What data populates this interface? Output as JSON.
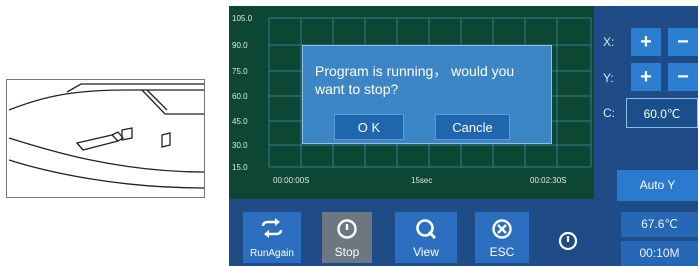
{
  "chart": {
    "y_ticks": [
      "105.0",
      "90.0",
      "75.0",
      "60.0",
      "45.0",
      "30.0",
      "15.0"
    ],
    "x_labels": [
      "00:00:00S",
      "15sec",
      "00:02:30S"
    ]
  },
  "dialog": {
    "message": "Program is running， would you want to stop?",
    "ok_label": "O K",
    "cancel_label": "Cancle"
  },
  "right_panel": {
    "x_label": "X:",
    "y_label": "Y:",
    "c_label": "C:",
    "plus": "+",
    "minus": "−",
    "c_value": "60.0℃",
    "auto_y_label": "Auto Y",
    "temperature": "67.6℃",
    "time": "00:10M"
  },
  "toolbar": {
    "run_again": "RunAgain",
    "stop": "Stop",
    "view": "View",
    "esc": "ESC"
  },
  "colors": {
    "chart_bg": "#0d4633",
    "panel_bg": "#1f4b86",
    "dialog_bg": "#3c86c6",
    "button_blue": "#2c7ed0",
    "stop_active": "#6d7781"
  }
}
